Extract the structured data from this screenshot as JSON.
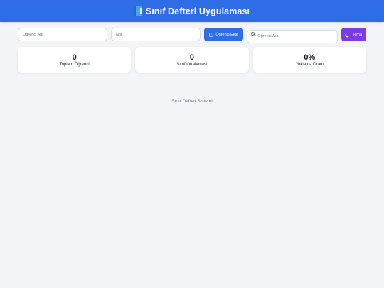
{
  "header": {
    "icon": "book-icon",
    "title": "Sınıf Defteri Uygulaması",
    "color": "#2f6de6"
  },
  "toolbar": {
    "student_name_placeholder": "Öğrenci Adı",
    "note_placeholder": "Not",
    "add_button_label": "Öğrenci Ekle",
    "add_button_icon": "add-icon",
    "search_placeholder": "Öğrenci Ara",
    "search_icon": "search-icon",
    "theme_button_label": "Tema",
    "theme_button_icon": "moon-icon",
    "theme_color": "#7c3aed"
  },
  "stats": [
    {
      "value": "0",
      "label": "Toplam Öğrenci"
    },
    {
      "value": "0",
      "label": "Sınıf Ortalaması"
    },
    {
      "value": "0%",
      "label": "Yoklama Oranı"
    }
  ],
  "footer": {
    "text": "Sınıf Defteri Sistemi"
  }
}
